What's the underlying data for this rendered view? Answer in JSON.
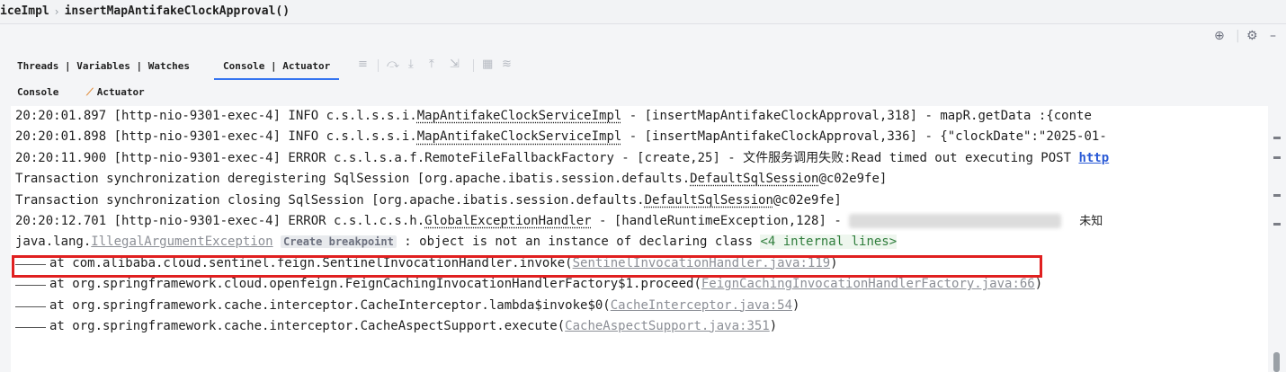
{
  "breadcrumb": {
    "class_name": "iceImpl",
    "method_name": "insertMapAntifakeClockApproval()"
  },
  "tabs": {
    "threads": "Threads | Variables | Watches",
    "console": "Console | Actuator"
  },
  "subtabs": {
    "console": "Console",
    "actuator": "Actuator"
  },
  "console": {
    "lines": {
      "l1": {
        "prefix": "20:20:01.897 [http-nio-9301-exec-4] INFO  c.s.l.s.s.i.",
        "cls": "MapAntifakeClockServiceImpl",
        "suffix": " - [insertMapAntifakeClockApproval,318] - mapR.getData   :{conte"
      },
      "l2": {
        "prefix": "20:20:01.898 [http-nio-9301-exec-4] INFO  c.s.l.s.s.i.",
        "cls": "MapAntifakeClockServiceImpl",
        "suffix": " - [insertMapAntifakeClockApproval,336] - {\"clockDate\":\"2025-01-"
      },
      "l3": {
        "text": "20:20:11.900 [http-nio-9301-exec-4] ERROR c.s.l.s.a.f.RemoteFileFallbackFactory - [create,25] - 文件服务调用失败:Read timed out executing POST ",
        "link": "http"
      },
      "l4": {
        "prefix": "Transaction synchronization deregistering SqlSession [org.apache.ibatis.session.defaults.",
        "cls": "DefaultSqlSession",
        "suffix": "@c02e9fe]"
      },
      "l5": {
        "prefix": "Transaction synchronization closing SqlSession [org.apache.ibatis.session.defaults.",
        "cls": "DefaultSqlSession",
        "suffix": "@c02e9fe]"
      },
      "l6": {
        "prefix": "20:20:12.701 [http-nio-9301-exec-4] ERROR c.s.l.c.s.h.",
        "cls": "GlobalExceptionHandler",
        "suffix": " - [handleRuntimeException,128] - ",
        "tail": "未知"
      },
      "l7": {
        "prefix": "java.lang.",
        "exception": "IllegalArgumentException",
        "breakpoint": "Create breakpoint",
        "message": " : object is not an instance of declaring class ",
        "internal": "<4 internal lines>"
      },
      "s1": {
        "text": "at com.alibaba.cloud.sentinel.feign.SentinelInvocationHandler.invoke(",
        "file": "SentinelInvocationHandler.java:119",
        "close": ")"
      },
      "s2": {
        "text": "at org.springframework.cloud.openfeign.FeignCachingInvocationHandlerFactory$1.proceed(",
        "file": "FeignCachingInvocationHandlerFactory.java:66",
        "close": ")"
      },
      "s3": {
        "text": "at org.springframework.cache.interceptor.CacheInterceptor.lambda$invoke$0(",
        "file": "CacheInterceptor.java:54",
        "close": ")"
      },
      "s4": {
        "text": "at org.springframework.cache.interceptor.CacheAspectSupport.execute(",
        "file": "CacheAspectSupport.java:351",
        "close": ")"
      }
    }
  },
  "icons": {
    "settings": "gear-icon",
    "target": "crosshair-icon"
  },
  "colors": {
    "accent": "#3574f0",
    "highlight": "#e02020",
    "link": "#2b5bd6"
  }
}
